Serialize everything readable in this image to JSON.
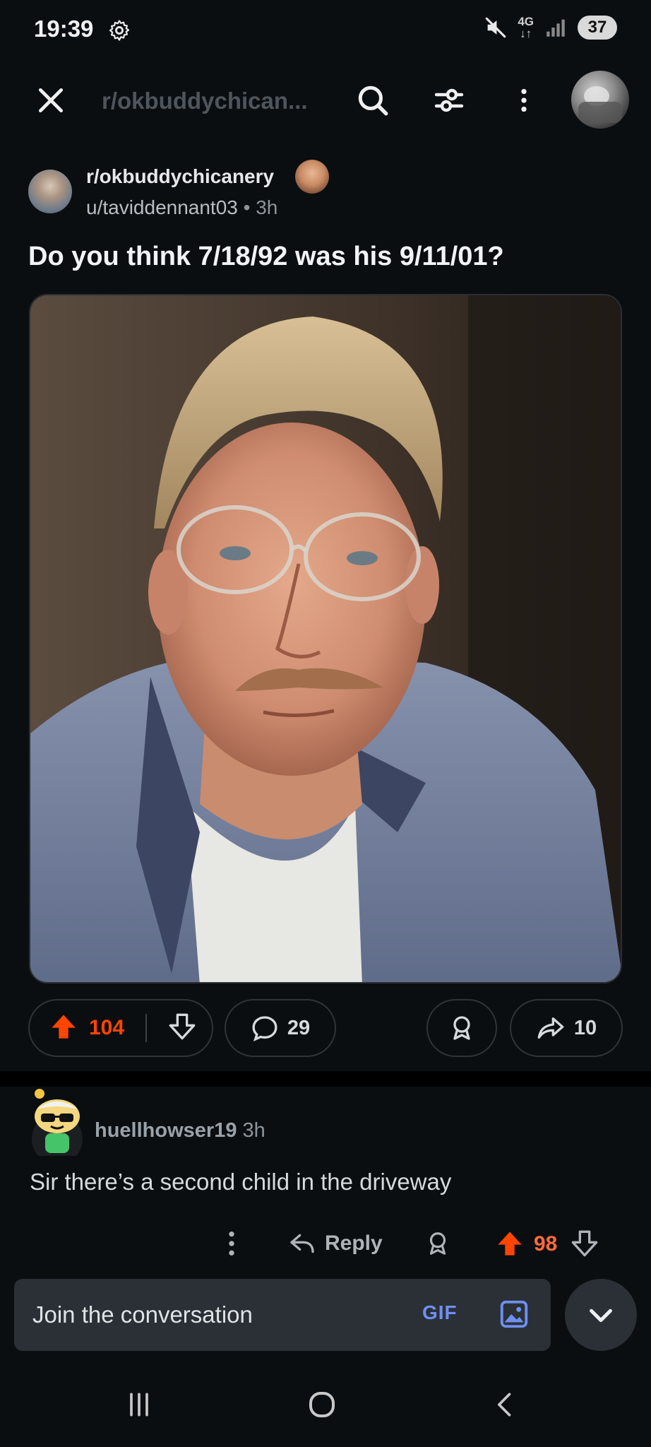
{
  "status_bar": {
    "time": "19:39",
    "network": "4G",
    "battery": "37"
  },
  "header": {
    "subreddit_title": "r/okbuddychican..."
  },
  "post": {
    "subreddit": "r/okbuddychicanery",
    "author": "u/taviddennant03",
    "separator": "•",
    "age": "3h",
    "title": "Do you think 7/18/92 was his 9/11/01?",
    "upvotes": "104",
    "comments": "29",
    "shares": "10"
  },
  "comment": {
    "author": "huellhowser19",
    "age": "3h",
    "body": "Sir there’s a second child in the driveway",
    "reply_label": "Reply",
    "score": "98"
  },
  "composer": {
    "placeholder": "Join the conversation",
    "gif_label": "GIF"
  },
  "colors": {
    "background": "#0b0e11",
    "upvote_accent": "#ff4500",
    "gif_accent": "#6f8ff2",
    "panel": "#2a3036"
  }
}
